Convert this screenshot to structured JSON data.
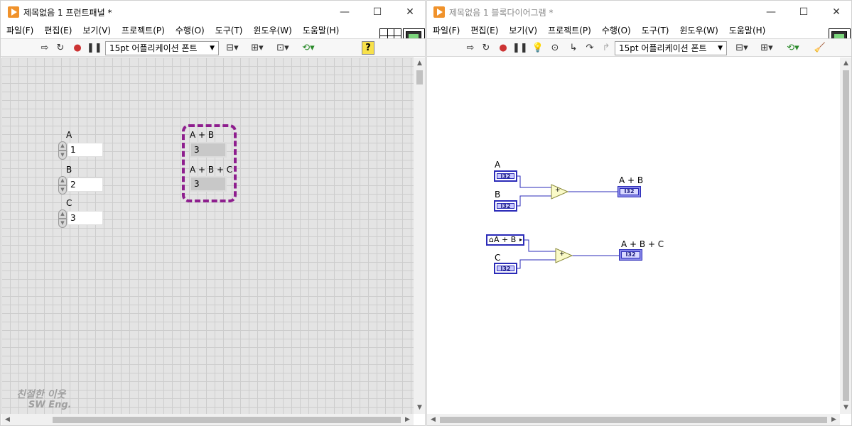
{
  "front_panel": {
    "title": "제목없음 1 프런트패널 *",
    "menu": [
      "파일(F)",
      "편집(E)",
      "보기(V)",
      "프로젝트(P)",
      "수행(O)",
      "도구(T)",
      "윈도우(W)",
      "도움말(H)"
    ],
    "font_select": "15pt 어플리케이션 폰트",
    "help_label": "?",
    "vi_icon_number": "1",
    "controls": [
      {
        "label": "A",
        "value": "1"
      },
      {
        "label": "B",
        "value": "2"
      },
      {
        "label": "C",
        "value": "3"
      }
    ],
    "indicators": [
      {
        "label": "A + B",
        "value": "3"
      },
      {
        "label": "A + B + C",
        "value": "3"
      }
    ],
    "watermark_line1": "친절한 이웃",
    "watermark_line2": "SW Eng."
  },
  "block_diagram": {
    "title": "제목없음 1 블록다이어그램 *",
    "menu": [
      "파일(F)",
      "편집(E)",
      "보기(V)",
      "프로젝트(P)",
      "수행(O)",
      "도구(T)",
      "윈도우(W)",
      "도움말(H)"
    ],
    "font_select": "15pt 어플리케이션 폰트",
    "vi_icon_number": "1",
    "terminals": {
      "a_label": "A",
      "b_label": "B",
      "c_label": "C",
      "ab_label": "A + B",
      "abc_label": "A + B + C",
      "type_tag": "I32",
      "local_var_label": "A + B",
      "add_symbol": "+"
    }
  },
  "window_buttons": {
    "minimize": "—",
    "maximize": "☐",
    "close": "✕"
  },
  "colors": {
    "wire_blue": "#2b2bb8",
    "selection_purple": "#8e1e8e",
    "labview_orange": "#f0922b",
    "add_node_fill": "#fafac8"
  }
}
